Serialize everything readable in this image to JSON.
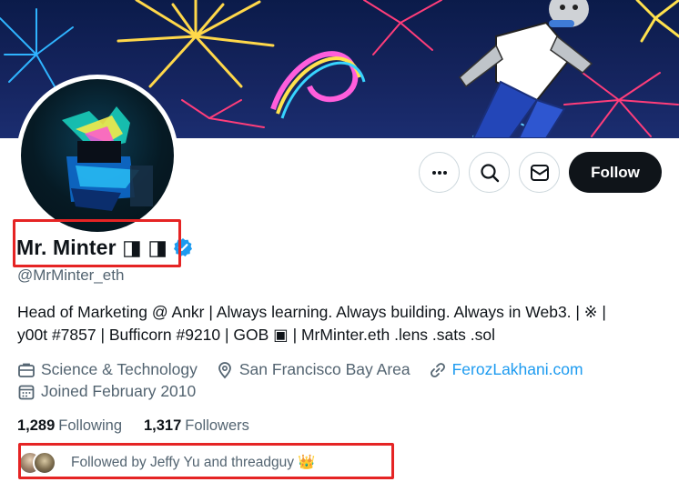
{
  "profile": {
    "display_name": "Mr. Minter ◨ ◨",
    "handle": "@MrMinter_eth",
    "bio_line1": "Head of Marketing @ Ankr | Always learning. Always building. Always in Web3. | ※ |",
    "bio_line2": "y00t #7857 | Bufficorn #9210 | GOB ▣ | MrMinter.eth .lens .sats .sol",
    "category": "Science & Technology",
    "location": "San Francisco Bay Area",
    "website": "FerozLakhani.com",
    "joined": "Joined February 2010",
    "following_count": "1,289",
    "following_label": "Following",
    "followers_count": "1,317",
    "followers_label": "Followers",
    "followed_by": "Followed by Jeffy Yu and threadguy 👑"
  },
  "actions": {
    "more_icon": "more-horizontal-icon",
    "search_icon": "search-icon",
    "message_icon": "envelope-icon",
    "follow_label": "Follow"
  },
  "colors": {
    "accent": "#1d9bf0",
    "follow_button_bg": "#0f1419",
    "secondary_text": "#536471",
    "highlight_box": "#e52424"
  }
}
